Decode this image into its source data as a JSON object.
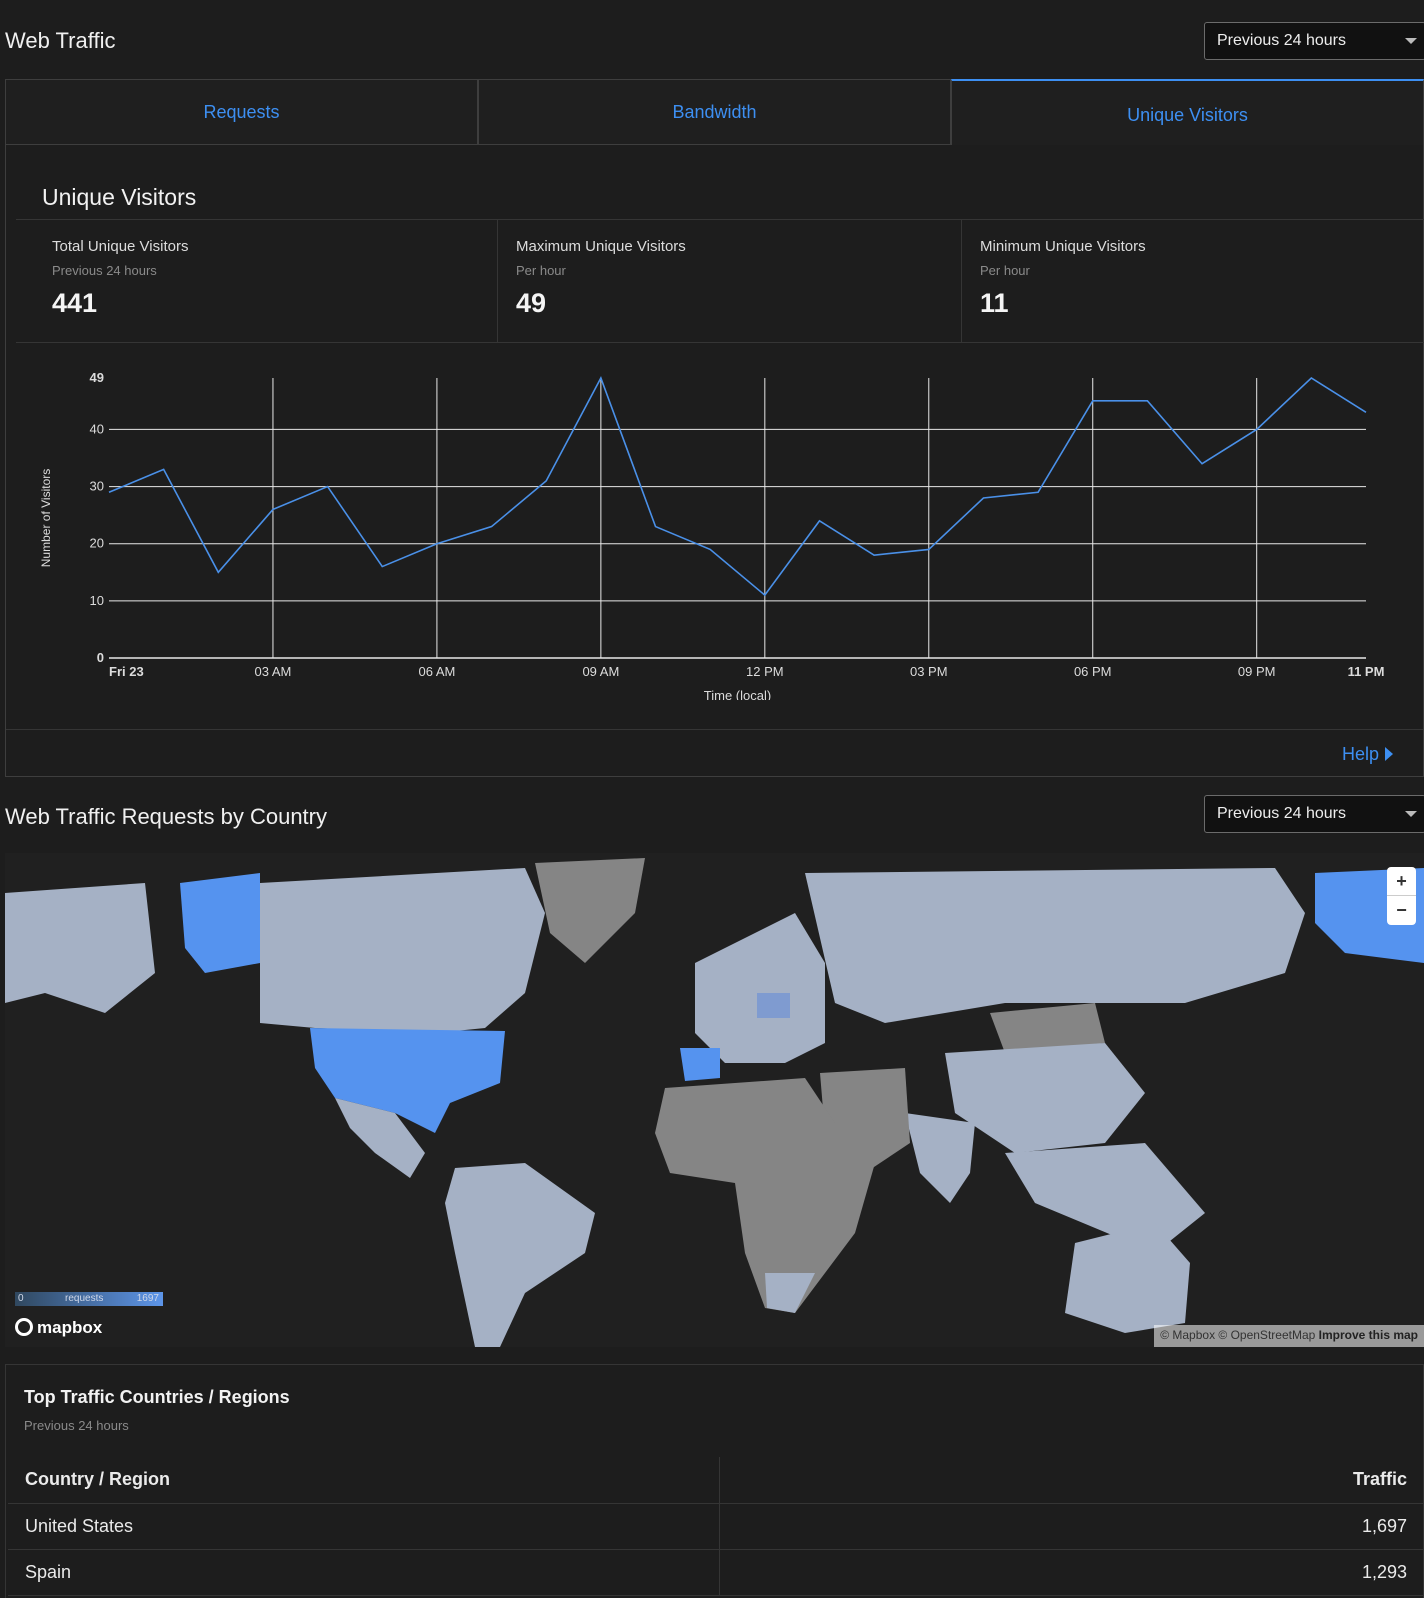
{
  "header": {
    "title": "Web Traffic",
    "range": "Previous 24 hours"
  },
  "tabs": [
    {
      "label": "Requests",
      "active": false
    },
    {
      "label": "Bandwidth",
      "active": false
    },
    {
      "label": "Unique Visitors",
      "active": true
    }
  ],
  "panel": {
    "title": "Unique Visitors",
    "stats": [
      {
        "label": "Total Unique Visitors",
        "sub": "Previous 24 hours",
        "value": "441"
      },
      {
        "label": "Maximum Unique Visitors",
        "sub": "Per hour",
        "value": "49"
      },
      {
        "label": "Minimum Unique Visitors",
        "sub": "Per hour",
        "value": "11"
      }
    ],
    "help": "Help"
  },
  "chart_data": {
    "type": "line",
    "x": [
      0,
      1,
      2,
      3,
      4,
      5,
      6,
      7,
      8,
      9,
      10,
      11,
      12,
      13,
      14,
      15,
      16,
      17,
      18,
      19,
      20,
      21,
      22,
      23
    ],
    "series": [
      {
        "values": [
          29,
          33,
          15,
          26,
          30,
          16,
          20,
          23,
          31,
          49,
          23,
          19,
          11,
          24,
          18,
          19,
          28,
          29,
          45,
          45,
          34,
          40,
          49,
          43
        ]
      }
    ],
    "xticks": [
      "Fri 23",
      "03 AM",
      "06 AM",
      "09 AM",
      "12 PM",
      "03 PM",
      "06 PM",
      "09 PM",
      "11 PM"
    ],
    "yticks": [
      "0",
      "10",
      "20",
      "30",
      "40",
      "49"
    ],
    "xlabel": "Time (local)",
    "ylabel": "Number of Visitors",
    "ylim": [
      0,
      49
    ],
    "line_color": "#4a90e8",
    "grid": true
  },
  "map_section": {
    "title": "Web Traffic Requests by Country",
    "range": "Previous 24 hours",
    "legend": {
      "label": "requests",
      "min": "0",
      "max": "1697"
    },
    "logo": "mapbox",
    "attribution": "© Mapbox © OpenStreetMap",
    "improve": "Improve this map",
    "colors": {
      "high": "#5593ef",
      "mid": "#7f9bd0",
      "low": "#a5b1c5",
      "none": "#858585"
    }
  },
  "countries": {
    "title": "Top Traffic Countries / Regions",
    "sub": "Previous 24 hours",
    "columns": [
      "Country / Region",
      "Traffic"
    ],
    "rows": [
      {
        "country": "United States",
        "traffic": "1,697"
      },
      {
        "country": "Spain",
        "traffic": "1,293"
      }
    ]
  }
}
